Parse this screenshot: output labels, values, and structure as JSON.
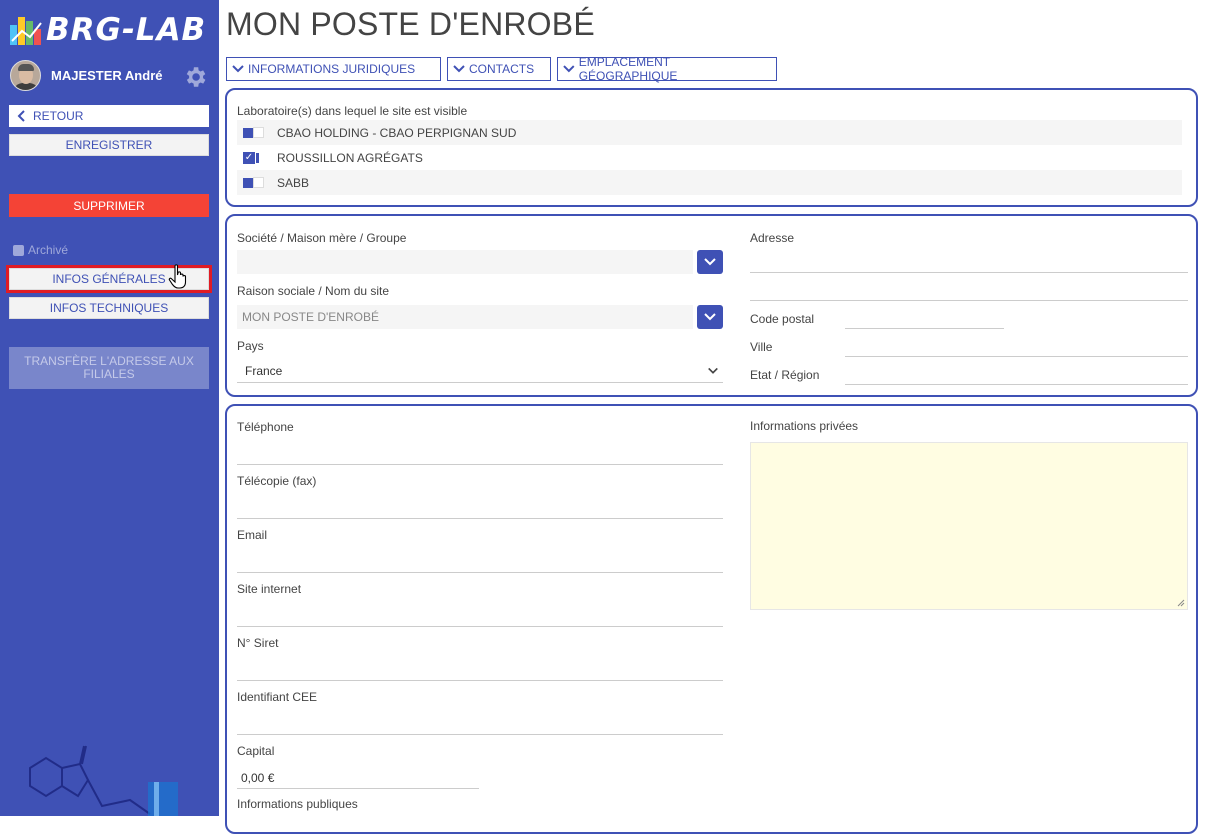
{
  "app": {
    "logo_text": "BRG-LAB"
  },
  "user": {
    "name": "MAJESTER André"
  },
  "sidebar": {
    "back_label": "RETOUR",
    "save_label": "ENREGISTRER",
    "delete_label": "SUPPRIMER",
    "archive_label": "Archivé",
    "archive_checked": false,
    "general_info_label": "INFOS GÉNÉRALES",
    "tech_info_label": "INFOS TECHNIQUES",
    "transfer_label": "TRANSFÈRE L'ADRESSE AUX FILIALES"
  },
  "page": {
    "title": "MON POSTE D'ENROBÉ",
    "tabs": [
      {
        "label": "INFORMATIONS JURIDIQUES"
      },
      {
        "label": "CONTACTS"
      },
      {
        "label": "EMPLACEMENT GÉOGRAPHIQUE"
      }
    ]
  },
  "labs": {
    "heading": "Laboratoire(s) dans lequel le site est visible",
    "items": [
      {
        "name": "CBAO HOLDING - CBAO PERPIGNAN SUD",
        "checked": false
      },
      {
        "name": "ROUSSILLON AGRÉGATS",
        "checked": true
      },
      {
        "name": "SABB",
        "checked": false
      }
    ]
  },
  "identity": {
    "company_label": "Société / Maison mère / Groupe",
    "company_value": "",
    "site_name_label": "Raison sociale / Nom du site",
    "site_name_value": "MON POSTE D'ENROBÉ",
    "country_label": "Pays",
    "country_value": "France",
    "address_label": "Adresse",
    "postal_label": "Code postal",
    "city_label": "Ville",
    "region_label": "Etat / Région"
  },
  "contact": {
    "phone_label": "Téléphone",
    "fax_label": "Télécopie (fax)",
    "email_label": "Email",
    "website_label": "Site internet",
    "siret_label": "N° Siret",
    "cee_label": "Identifiant CEE",
    "capital_label": "Capital",
    "capital_value": "0,00 €",
    "public_info_label": "Informations publiques",
    "private_info_label": "Informations privées"
  },
  "colors": {
    "sidebar": "#3f51b5",
    "accent": "#3f51b5",
    "danger": "#f44336",
    "highlight_outline": "#e01b24",
    "private_notes_bg": "#fffde2"
  }
}
